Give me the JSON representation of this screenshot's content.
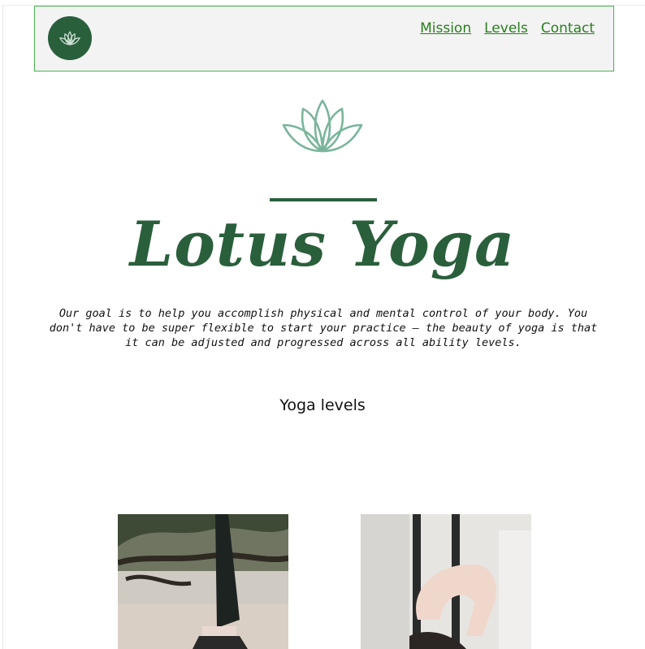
{
  "nav": {
    "logo_icon": "lotus-icon",
    "links": [
      "Mission",
      "Levels",
      "Contact"
    ]
  },
  "hero": {
    "icon": "lotus-icon",
    "title": "Lotus Yoga",
    "mission": "Our goal is to help you accomplish physical and mental control of your body. You don't have to be super flexible to start your practice – the beauty of yoga is that it can be adjusted and progressed across all ability levels."
  },
  "levels": {
    "heading": "Yoga levels"
  },
  "colors": {
    "brand_green": "#2a5f3c",
    "lotus_light": "#7ab59b",
    "link_green": "#2a7d1f",
    "nav_border": "#4caf50"
  }
}
